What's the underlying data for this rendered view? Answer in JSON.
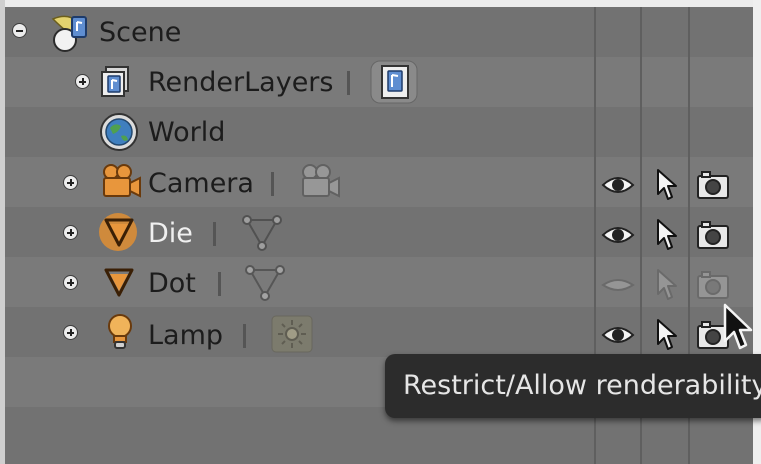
{
  "outliner": {
    "items": [
      {
        "name": "Scene",
        "icon": "scene-icon",
        "expander": "collapse"
      },
      {
        "name": "RenderLayers",
        "icon": "render-layers-icon",
        "expander": "expand"
      },
      {
        "name": "World",
        "icon": "world-icon",
        "expander": "none"
      },
      {
        "name": "Camera",
        "icon": "camera-object-icon",
        "expander": "expand",
        "restrict": {
          "visible": true,
          "selectable": true,
          "renderable": true
        }
      },
      {
        "name": "Die",
        "icon": "mesh-object-icon",
        "expander": "expand",
        "active": true,
        "restrict": {
          "visible": true,
          "selectable": true,
          "renderable": true
        }
      },
      {
        "name": "Dot",
        "icon": "mesh-object-icon",
        "expander": "expand",
        "restrict": {
          "visible": false,
          "selectable": false,
          "renderable": false
        }
      },
      {
        "name": "Lamp",
        "icon": "lamp-object-icon",
        "expander": "expand",
        "restrict": {
          "visible": true,
          "selectable": true,
          "renderable": true
        }
      }
    ]
  },
  "tooltip": {
    "text": "Restrict/Allow renderability"
  },
  "colors": {
    "background": "#727272",
    "active_highlight": "#cf8a3c",
    "tooltip_bg": "#2c2c2c"
  }
}
